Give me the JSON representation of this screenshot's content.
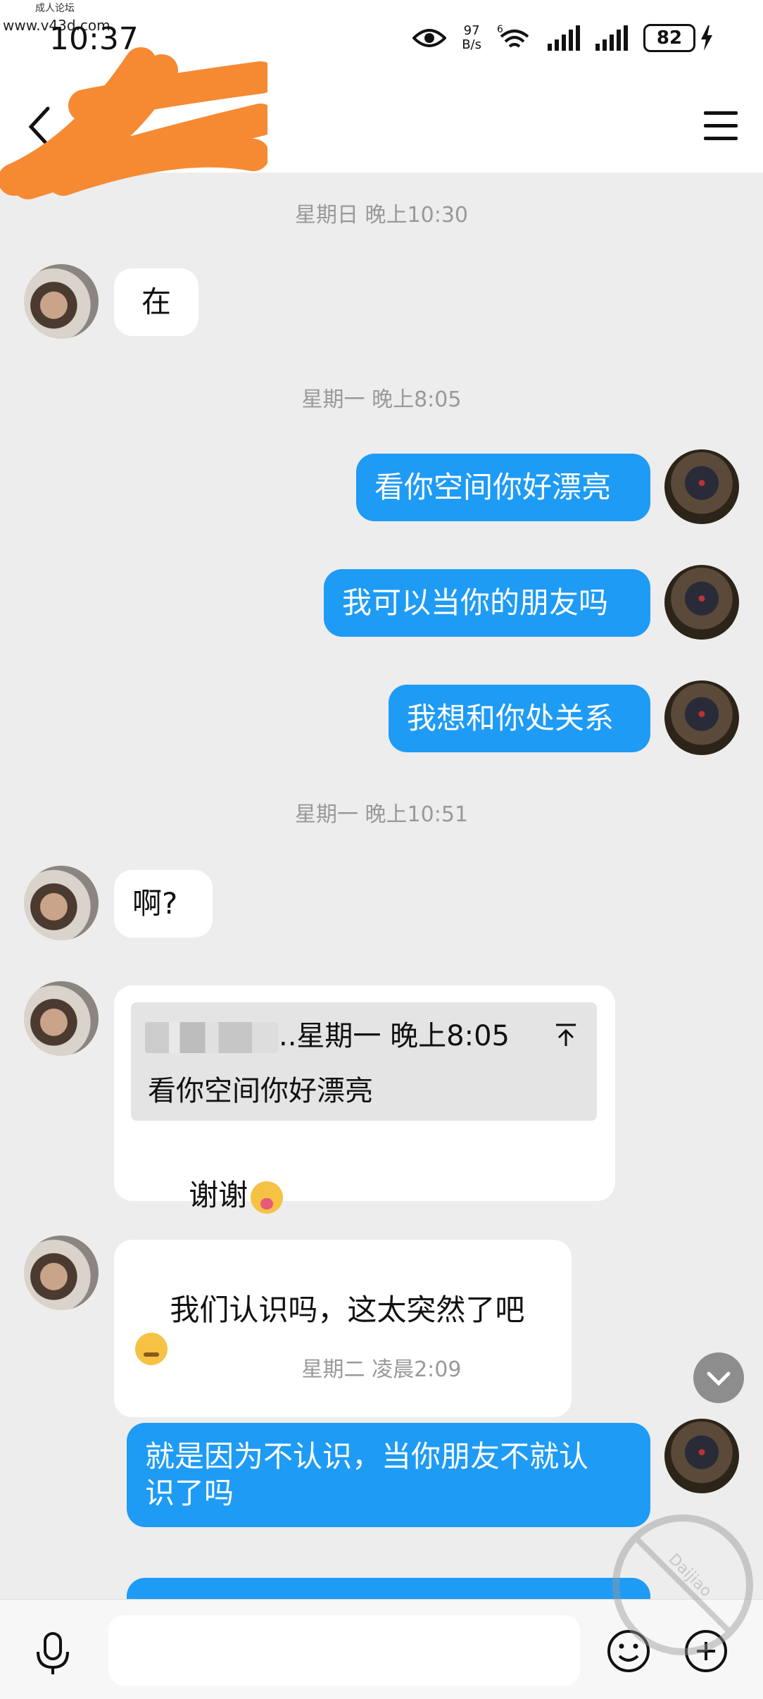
{
  "status_bar": {
    "watermark_title": "成人论坛",
    "watermark_url": "www.v43d.com",
    "time": "10:37",
    "net_speed_value": "97",
    "net_speed_unit": "B/s",
    "wifi_label": "6",
    "battery": "82"
  },
  "header": {
    "contact_name": "",
    "contact_sub": "›"
  },
  "messages": [
    {
      "type": "time",
      "text": "星期日 晚上10:30"
    },
    {
      "type": "in",
      "text": "在"
    },
    {
      "type": "time",
      "text": "星期一 晚上8:05"
    },
    {
      "type": "out",
      "text": "看你空间你好漂亮"
    },
    {
      "type": "out",
      "text": "我可以当你的朋友吗"
    },
    {
      "type": "out",
      "text": "我想和你处关系"
    },
    {
      "type": "time",
      "text": "星期一 晚上10:51"
    },
    {
      "type": "in",
      "text": "啊?"
    },
    {
      "type": "in_quote",
      "quote_time": "..星期一 晚上8:05",
      "quote_text": "看你空间你好漂亮",
      "text": "谢谢",
      "emoji": "tongue-emoji"
    },
    {
      "type": "in",
      "text": "我们认识吗，这太突然了吧",
      "emoji": "confounded-emoji"
    },
    {
      "type": "time",
      "text": "星期二 凌晨2:09"
    },
    {
      "type": "out",
      "text": "就是因为不认识，当你朋友不就认\n识了吗"
    }
  ],
  "input": {
    "placeholder": ""
  },
  "stamp": {
    "text": "Daijiao"
  },
  "colors": {
    "outgoing_bubble": "#1E9BF5",
    "incoming_bubble": "#FFFFFF",
    "background": "#EDEDED"
  }
}
